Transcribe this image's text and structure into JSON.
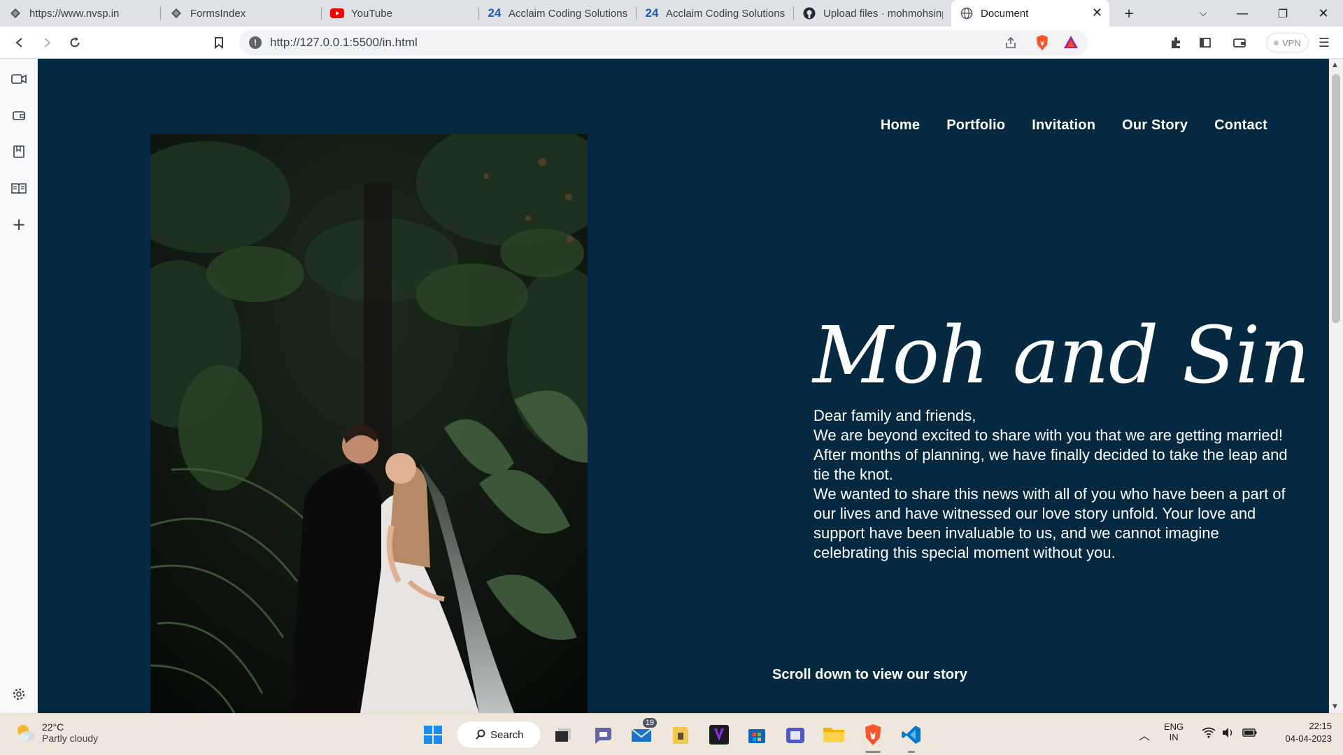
{
  "browser": {
    "tabs": [
      {
        "title": "https://www.nvsp.in",
        "icon": "forms-icon"
      },
      {
        "title": "FormsIndex",
        "icon": "forms-icon"
      },
      {
        "title": "YouTube",
        "icon": "youtube-icon"
      },
      {
        "title": "Acclaim Coding Solutions",
        "icon": "24-icon"
      },
      {
        "title": "Acclaim Coding Solutions",
        "icon": "24-icon"
      },
      {
        "title": "Upload files · mohmohsinp",
        "icon": "github-icon"
      },
      {
        "title": "Document",
        "icon": "globe-icon",
        "active": true
      }
    ],
    "url": "http://127.0.0.1:5500/in.html",
    "vpn_label": "VPN",
    "accent_colors": {
      "brave": "#fb542b",
      "youtube": "#ff0000",
      "vscode": "#007acc"
    }
  },
  "page": {
    "background": "#042941",
    "nav": [
      "Home",
      "Portfolio",
      "Invitation",
      "Our Story",
      "Contact"
    ],
    "heading": "Moh and Sin",
    "message": [
      "Dear family and friends,",
      "We are beyond excited to share with you that we are getting married! After months of planning, we have finally decided to take the leap and tie the knot.",
      "We wanted to share this news with all of you who have been a part of our lives and have witnessed our love story unfold. Your love and support have been invaluable to us, and we cannot imagine celebrating this special moment without you."
    ],
    "scroll_hint": "Scroll down to view our story"
  },
  "taskbar": {
    "weather": {
      "temp": "22°C",
      "condition": "Partly cloudy"
    },
    "search_label": "Search",
    "mail_badge": "19",
    "language": {
      "line1": "ENG",
      "line2": "IN"
    },
    "clock": {
      "time": "22:15",
      "date": "04-04-2023"
    }
  }
}
